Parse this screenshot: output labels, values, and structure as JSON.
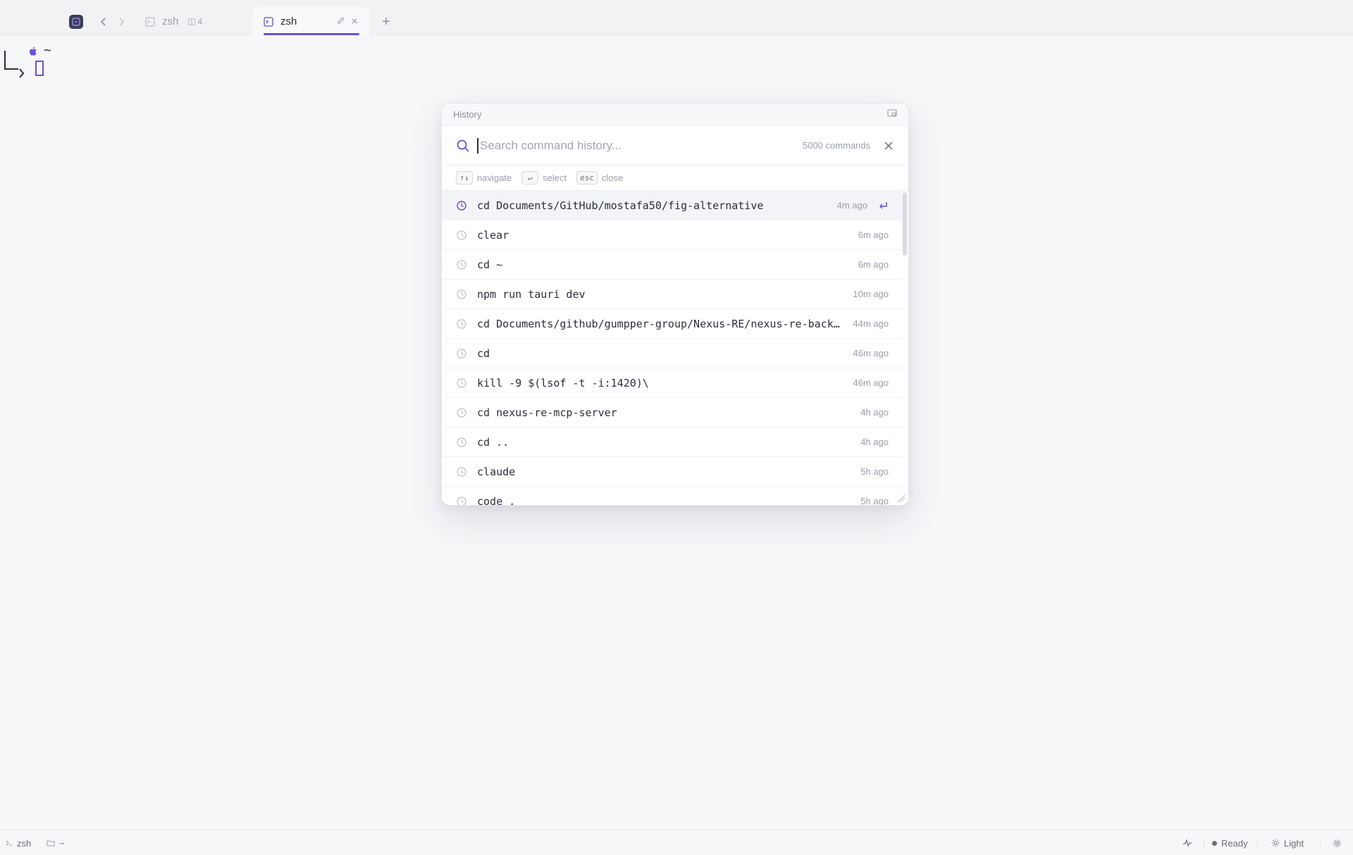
{
  "tabbar": {
    "tabs": [
      {
        "label": "zsh",
        "badge": "4",
        "active": false
      },
      {
        "label": "zsh",
        "active": true
      }
    ],
    "new_tab_label": "+"
  },
  "terminal": {
    "path": "~"
  },
  "history": {
    "title": "History",
    "search_placeholder": "Search command history...",
    "count_label": "5000 commands",
    "hints": [
      {
        "key": "↑↓",
        "label": "navigate"
      },
      {
        "key": "↵",
        "label": "select"
      },
      {
        "key": "esc",
        "label": "close"
      }
    ],
    "items": [
      {
        "command": "cd Documents/GitHub/mostafa50/fig-alternative",
        "time": "4m ago",
        "selected": true
      },
      {
        "command": "clear",
        "time": "6m ago"
      },
      {
        "command": "cd ~",
        "time": "6m ago"
      },
      {
        "command": "npm run tauri dev",
        "time": "10m ago"
      },
      {
        "command": "cd Documents/github/gumpper-group/Nexus-RE/nexus-re-backend",
        "time": "44m ago"
      },
      {
        "command": "cd",
        "time": "46m ago"
      },
      {
        "command": "kill -9 $(lsof -t -i:1420)\\",
        "time": "46m ago"
      },
      {
        "command": "cd nexus-re-mcp-server",
        "time": "4h ago"
      },
      {
        "command": "cd ..",
        "time": "4h ago"
      },
      {
        "command": "claude",
        "time": "5h ago"
      },
      {
        "command": "code .",
        "time": "5h ago"
      }
    ]
  },
  "statusbar": {
    "shell": "zsh",
    "cwd": "~",
    "status": "Ready",
    "theme": "Light"
  },
  "colors": {
    "accent": "#6a4fd6",
    "background": "#f6f7f9"
  }
}
